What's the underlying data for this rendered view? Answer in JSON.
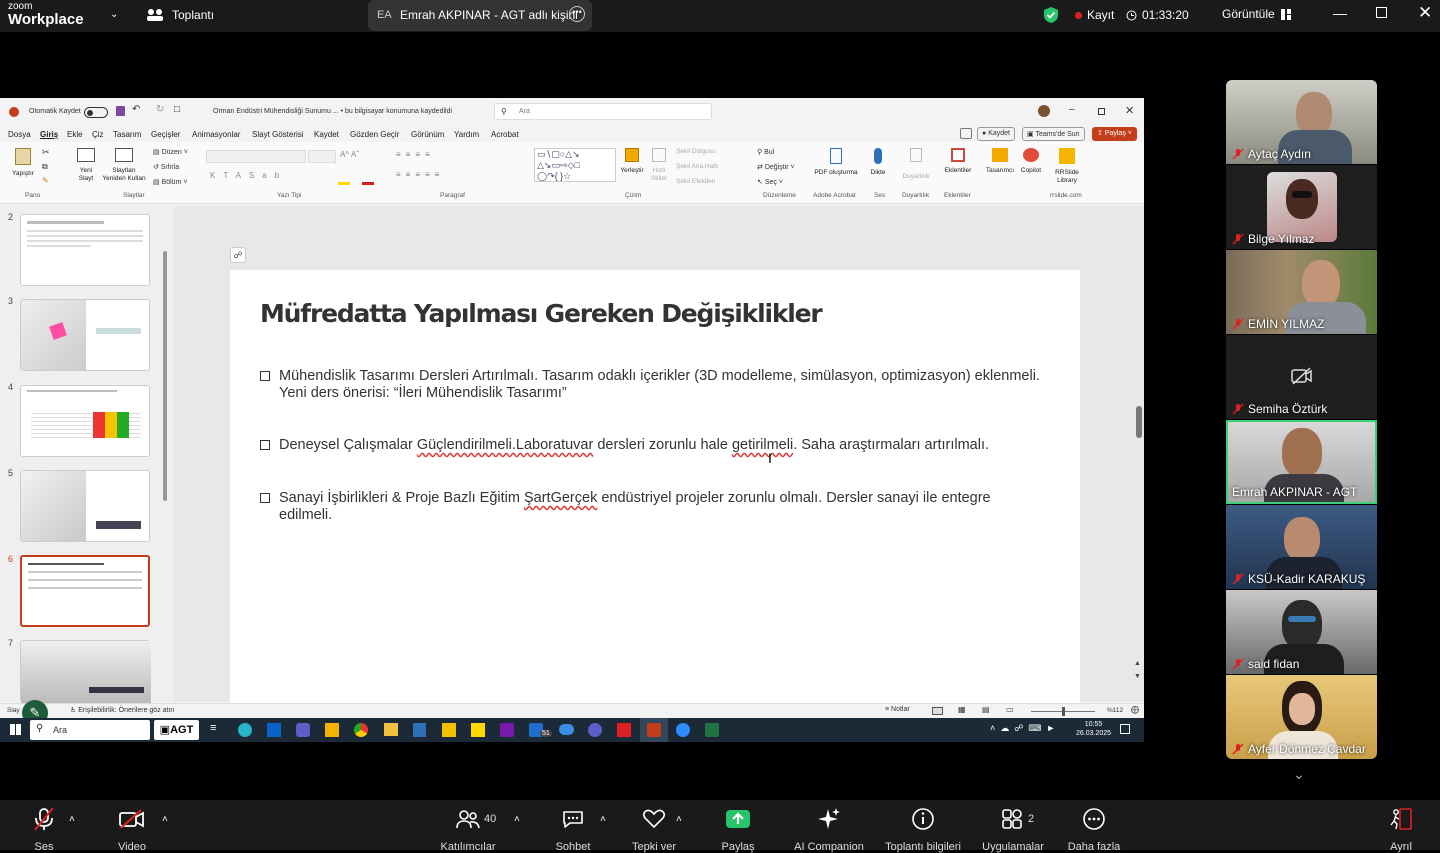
{
  "zoom": {
    "logo_line1": "zoom",
    "logo_line2": "Workplace",
    "meeting_label": "Toplantı",
    "presenter": {
      "initials": "EA",
      "label": "Emrah AKPINAR - AGT adlı kişini"
    },
    "record_label": "Kayıt",
    "timer": "01:33:20",
    "view_label": "Görüntüle"
  },
  "ppt": {
    "autosave": "Otomatik Kaydet",
    "title": "Orman Endüstri Mühendisliği Sunumu ...  •  bu bilgisayar konumuna kaydedildi",
    "search": "Ara",
    "menus": [
      "Dosya",
      "Giriş",
      "Ekle",
      "Çiz",
      "Tasarım",
      "Geçişler",
      "Animasyonlar",
      "Slayt Gösterisi",
      "Kaydet",
      "Gözden Geçir",
      "Görünüm",
      "Yardım",
      "Acrobat"
    ],
    "right_buttons": {
      "kaydet": "Kaydet",
      "teams": "Teams'de Sun",
      "paylas": "Paylaş"
    },
    "ribbon": {
      "paste": "Yapıştır",
      "new_slide": "Yeni Slayt",
      "reuse": "Slaytları Yeniden Kullan",
      "layout": "Düzen",
      "reset": "Sıfırla",
      "section": "Bölüm",
      "arrange": "Yerleştir",
      "quick_styles": "Hızlı Stiller",
      "fill": "Şekil Dolgusu",
      "outline": "Şekil Ana Hattı",
      "effects": "Şekil Efektleri",
      "find": "Bul",
      "replace": "Değiştir",
      "select": "Seç",
      "pdf": "PDF oluşturma",
      "dictate": "Dikte",
      "sensitivity": "Duyarlılık",
      "addins": "Eklentiler",
      "designer": "Tasarımcı",
      "copilot": "Copilot",
      "rrslide": "RRSlide Library",
      "groups": [
        "Pano",
        "Slaytlar",
        "Yazı Tipi",
        "Paragraf",
        "Çizim",
        "Düzenleme",
        "Adobe Acrobat",
        "Ses",
        "Duyarlılık",
        "Eklentiler",
        "rrslide.com"
      ]
    },
    "slide_numbers": [
      "2",
      "3",
      "4",
      "5",
      "6",
      "7"
    ],
    "slide": {
      "title": "Müfredatta Yapılması Gereken Değişiklikler",
      "b1": "Mühendislik Tasarımı Dersleri Artırılmalı. Tasarım odaklı içerikler (3D modelleme, simülasyon, optimizasyon) eklenmeli. Yeni ders önerisi: “İleri Mühendislik Tasarımı”",
      "b2a": " Deneysel Çalışmalar ",
      "b2b": "Güçlendirilmeli.Laboratuvar",
      "b2c": " dersleri zorunlu hale ",
      "b2d": "getirilmeli",
      "b2e": ". Saha araştırmaları artırılmalı.",
      "b3a": " Sanayi İşbirlikleri & Proje Bazlı Eğitim ",
      "b3b": "ŞartGerçek",
      "b3c": " endüstriyel projeler zorunlu olmalı. Dersler sanayi ile entegre edilmeli."
    },
    "status": {
      "slide": "Slay",
      "access": "Erişilebilirlik: Önerilere göz atın",
      "notes": "Notlar",
      "zoom": "%112"
    }
  },
  "taskbar": {
    "search": "Ara",
    "brand": "AGT",
    "time": "10:55",
    "date": "26.03.2025",
    "badge": "51"
  },
  "participants": [
    "Aytaç Aydın",
    "Bilge Yılmaz",
    "EMİN YILMAZ",
    "Semiha Öztürk",
    "Emrah AKPINAR - AGT",
    "KSÜ-Kadir KARAKUŞ",
    "said fidan",
    "Ayfer Dönmez Çavdar"
  ],
  "toolbar": {
    "audio": "Ses",
    "video": "Video",
    "participants": "Katılımcılar",
    "participants_count": "40",
    "chat": "Sohbet",
    "react": "Tepki ver",
    "share": "Paylaş",
    "ai": "AI Companion",
    "info": "Toplantı bilgileri",
    "apps": "Uygulamalar",
    "apps_count": "2",
    "more": "Daha fazla",
    "leave": "Ayrıl"
  },
  "colors": {
    "accent_green": "#27c46b",
    "record_red": "#e02020",
    "ppt_red": "#c43e1c",
    "speaker_border": "#3ad07a"
  }
}
